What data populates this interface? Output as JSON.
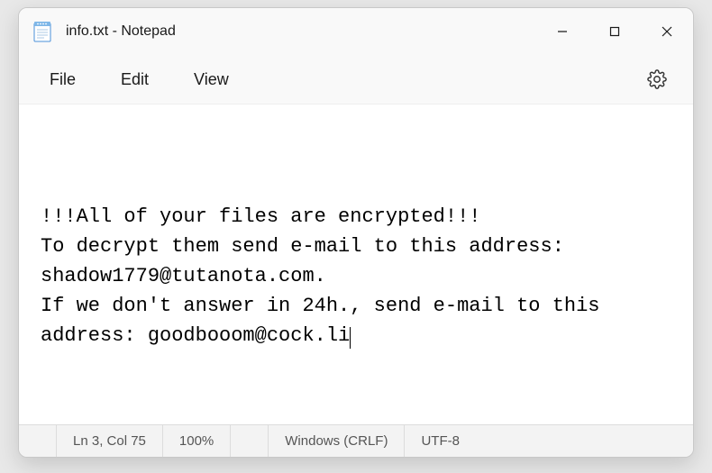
{
  "titlebar": {
    "title": "info.txt - Notepad"
  },
  "menu": {
    "file": "File",
    "edit": "Edit",
    "view": "View"
  },
  "editor": {
    "content": "!!!All of your files are encrypted!!!\nTo decrypt them send e-mail to this address: shadow1779@tutanota.com.\nIf we don't answer in 24h., send e-mail to this address: goodbooom@cock.li"
  },
  "statusbar": {
    "position": "Ln 3, Col 75",
    "zoom": "100%",
    "line_ending": "Windows (CRLF)",
    "encoding": "UTF-8"
  }
}
